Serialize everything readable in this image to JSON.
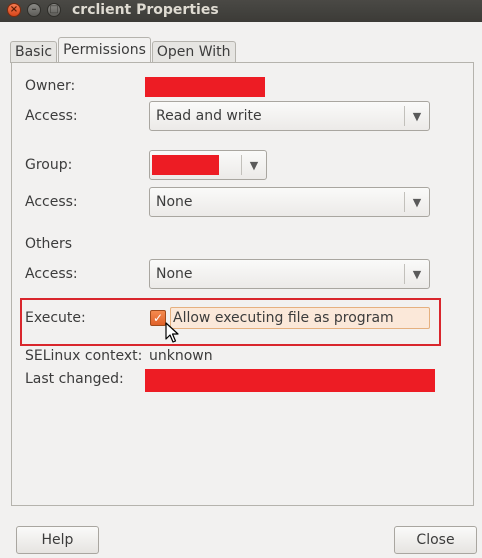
{
  "window": {
    "title": "crclient Properties"
  },
  "tabs": [
    {
      "label": "Basic"
    },
    {
      "label": "Permissions"
    },
    {
      "label": "Open With"
    }
  ],
  "permissions": {
    "owner_label": "Owner:",
    "owner_access_label": "Access:",
    "owner_access_value": "Read and write",
    "group_label": "Group:",
    "group_access_label": "Access:",
    "group_access_value": "None",
    "others_label": "Others",
    "others_access_label": "Access:",
    "others_access_value": "None",
    "execute_label": "Execute:",
    "execute_checkbox_label": "Allow executing file as program",
    "execute_checked": true,
    "selinux_label": "SELinux context:",
    "selinux_value": "unknown",
    "last_changed_label": "Last changed:"
  },
  "buttons": {
    "help": "Help",
    "close": "Close"
  },
  "colors": {
    "redaction": "#ed1c24",
    "highlight": "#d9262c",
    "checkbox": "#e8703a"
  }
}
